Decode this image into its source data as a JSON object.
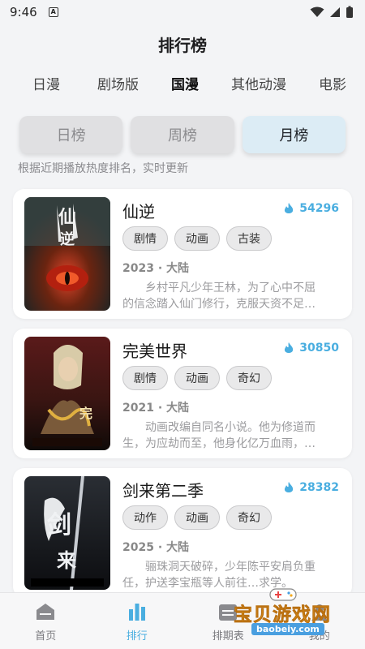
{
  "status_bar": {
    "time": "9:46"
  },
  "header": {
    "title": "排行榜"
  },
  "category_tabs": [
    {
      "label": "日漫",
      "active": false
    },
    {
      "label": "剧场版",
      "active": false
    },
    {
      "label": "国漫",
      "active": true
    },
    {
      "label": "其他动漫",
      "active": false
    },
    {
      "label": "电影",
      "active": false
    }
  ],
  "period_tabs": [
    {
      "label": "日榜",
      "active": false
    },
    {
      "label": "周榜",
      "active": false
    },
    {
      "label": "月榜",
      "active": true
    }
  ],
  "hint": "根据近期播放热度排名，实时更新",
  "items": [
    {
      "title": "仙逆",
      "heat": "54296",
      "tags": [
        "剧情",
        "动画",
        "古装"
      ],
      "meta": "2023 · 大陆",
      "desc_line1": "乡村平凡少年王林，为了心中不屈",
      "desc_line2": "的信念踏入仙门修行，克服天资不足…",
      "poster_colors": [
        "#2b3a3a",
        "#7a2a14",
        "#c23b1e"
      ]
    },
    {
      "title": "完美世界",
      "heat": "30850",
      "tags": [
        "剧情",
        "动画",
        "奇幻"
      ],
      "meta": "2021 · 大陆",
      "desc_line1": "动画改编自同名小说。他为修道而",
      "desc_line2": "生，为应劫而至，他身化亿万血雨，…",
      "poster_colors": [
        "#3a1a1a",
        "#8a6a4a",
        "#d8c08a"
      ]
    },
    {
      "title": "剑来第二季",
      "heat": "28382",
      "tags": [
        "动作",
        "动画",
        "奇幻"
      ],
      "meta": "2025 · 大陆",
      "desc_line1": "骊珠洞天破碎，少年陈平安肩负重",
      "desc_line2": "任，护送李宝瓶等人前往…求学。",
      "poster_colors": [
        "#1a1d22",
        "#3b4048",
        "#9aa0a8"
      ]
    }
  ],
  "bottom_nav": [
    {
      "label": "首页",
      "icon": "home-icon",
      "active": false
    },
    {
      "label": "排行",
      "icon": "bar-chart-icon",
      "active": true
    },
    {
      "label": "排期表",
      "icon": "schedule-icon",
      "active": false
    },
    {
      "label": "我的",
      "icon": "profile-icon",
      "active": false
    }
  ],
  "watermark": {
    "text": "宝贝游戏网",
    "url": "baobeiy.com"
  },
  "colors": {
    "accent": "#4aaee0",
    "tab_indicator": "#e84545"
  }
}
